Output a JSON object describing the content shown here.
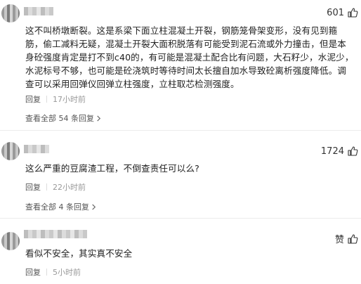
{
  "comments": [
    {
      "likes": "601",
      "text": "这不叫桥墩断裂。这是系梁下面立柱混凝土开裂，钢筋笼骨架变形，没有见到箍筋，偷工减料无疑，混凝土开裂大面积脱落有可能受到泥石流或外力撞击，但是本身砼强度肯定是打不到c40的，有可能是混凝土配合比有问题，大石籽少，水泥少，水泥标号不够，也可能是砼浇筑时等待时间太长擅自加水导致砼离析强度降低。调查可以采用回弹仪回弹立柱强度，立柱取芯检测强度。",
      "reply_label": "回复",
      "time": "17小时前",
      "view_all": "查看全部 54 条回复"
    },
    {
      "likes": "1724",
      "text": "这么严重的豆腐渣工程，不倒查责任可以么?",
      "reply_label": "回复",
      "time": "22小时前",
      "view_all": "查看全部 4 条回复"
    },
    {
      "likes": "赞",
      "text": "看似不安全，其实真不安全",
      "reply_label": "回复",
      "time": "5小时前"
    }
  ],
  "icons": {
    "like": "thumb-up-icon",
    "expand": "chevron-right-icon"
  },
  "colors": {
    "text": "#222222",
    "meta": "#999999",
    "divider": "#ececec"
  }
}
